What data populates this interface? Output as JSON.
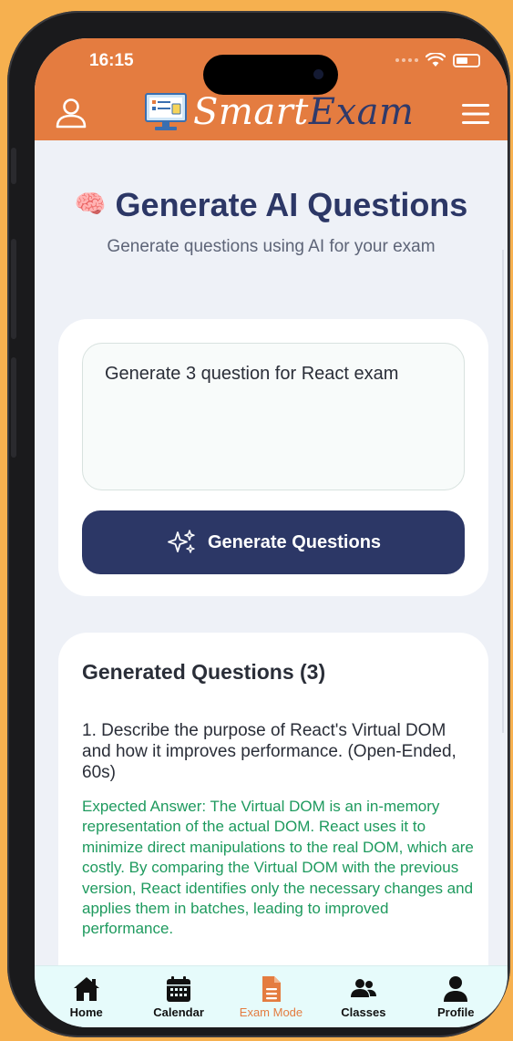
{
  "status_bar": {
    "time": "16:15"
  },
  "header": {
    "app_name_part1": "Smart",
    "app_name_part2": "Exam"
  },
  "page": {
    "title_emoji": "🧠",
    "title": "Generate AI Questions",
    "subtitle": "Generate questions using AI for your exam"
  },
  "prompt": {
    "value": "Generate 3 question for React exam",
    "button_label": "Generate Questions"
  },
  "questions": {
    "header": "Generated Questions (3)",
    "items": [
      {
        "question": "1. Describe the purpose of React's Virtual DOM and how it improves performance. (Open-Ended, 60s)",
        "answer": "Expected Answer: The Virtual DOM is an in-memory representation of the actual DOM. React uses it to minimize direct manipulations to the real DOM, which are costly. By comparing the Virtual DOM with the previous version, React identifies only the necessary changes and applies them in batches, leading to improved performance."
      }
    ]
  },
  "tabs": [
    {
      "label": "Home",
      "icon": "home-icon"
    },
    {
      "label": "Calendar",
      "icon": "calendar-icon"
    },
    {
      "label": "Exam Mode",
      "icon": "document-icon",
      "active": true
    },
    {
      "label": "Classes",
      "icon": "users-icon"
    },
    {
      "label": "Profile",
      "icon": "person-icon"
    }
  ],
  "colors": {
    "header": "#e47c40",
    "primary": "#2c3766",
    "answer": "#1e9a5e",
    "active_tab": "#e47c40",
    "background": "#f6b04f"
  }
}
